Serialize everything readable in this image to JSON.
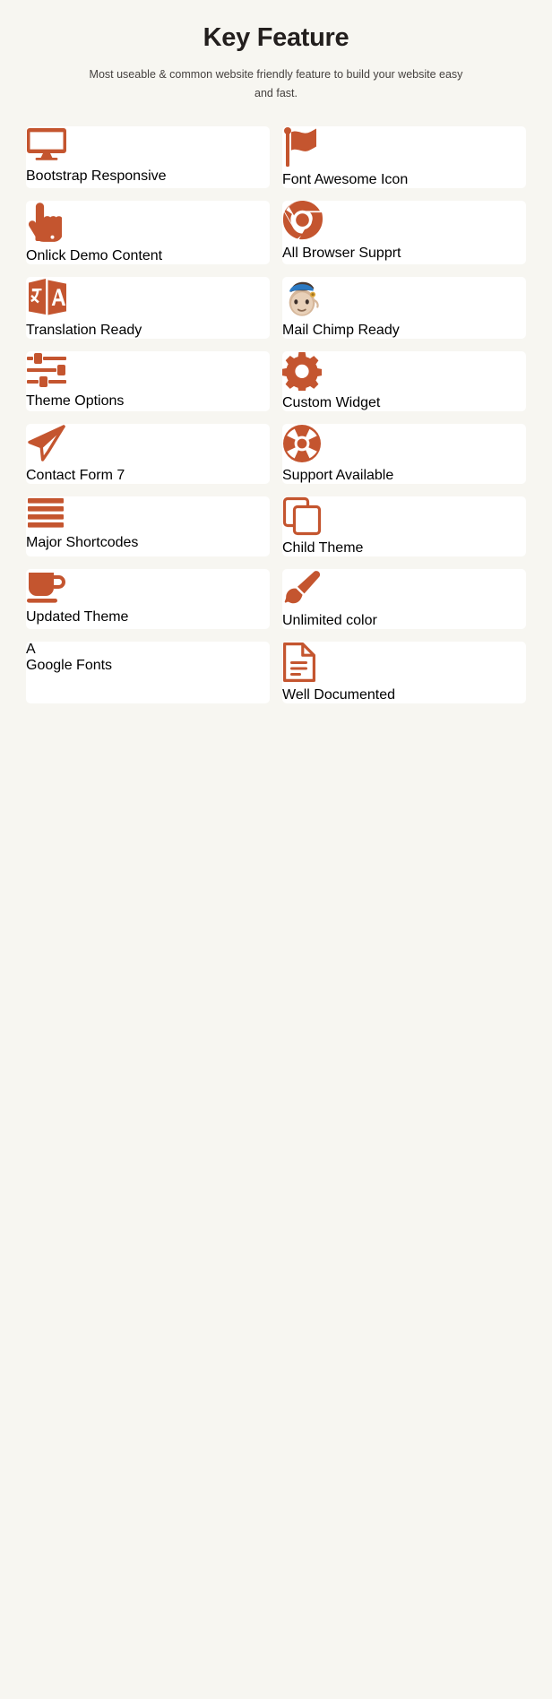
{
  "header": {
    "title": "Key Feature",
    "subtitle": "Most useable & common website friendly feature to build your website easy and fast."
  },
  "theme": {
    "background": "#f7f6f1",
    "card_background": "#ffffff",
    "accent": "#c4552f",
    "title_color": "#231f1e",
    "subtitle_color": "#45413f"
  },
  "features": [
    {
      "label": "Bootstrap Responsive",
      "icon": "desktop-monitor-icon"
    },
    {
      "label": "Font Awesome Icon",
      "icon": "flag-icon"
    },
    {
      "label": "Onlick Demo Content",
      "icon": "pointing-hand-icon"
    },
    {
      "label": "All Browser Supprt",
      "icon": "chrome-browser-icon"
    },
    {
      "label": "Translation Ready",
      "icon": "translate-icon"
    },
    {
      "label": "Mail Chimp Ready",
      "icon": "mailchimp-monkey-icon"
    },
    {
      "label": "Theme Options",
      "icon": "sliders-icon"
    },
    {
      "label": "Custom Widget",
      "icon": "gear-icon"
    },
    {
      "label": "Contact Form 7",
      "icon": "paper-plane-icon"
    },
    {
      "label": "Support Available",
      "icon": "lifebuoy-icon"
    },
    {
      "label": "Major Shortcodes",
      "icon": "hamburger-bars-icon"
    },
    {
      "label": "Child Theme",
      "icon": "copy-documents-icon"
    },
    {
      "label": "Updated Theme",
      "icon": "coffee-cup-icon"
    },
    {
      "label": "Unlimited color",
      "icon": "paint-brush-icon"
    },
    {
      "label": "Google Fonts",
      "icon": "letter-a-serif-icon"
    },
    {
      "label": "Well Documented",
      "icon": "document-file-icon"
    }
  ]
}
